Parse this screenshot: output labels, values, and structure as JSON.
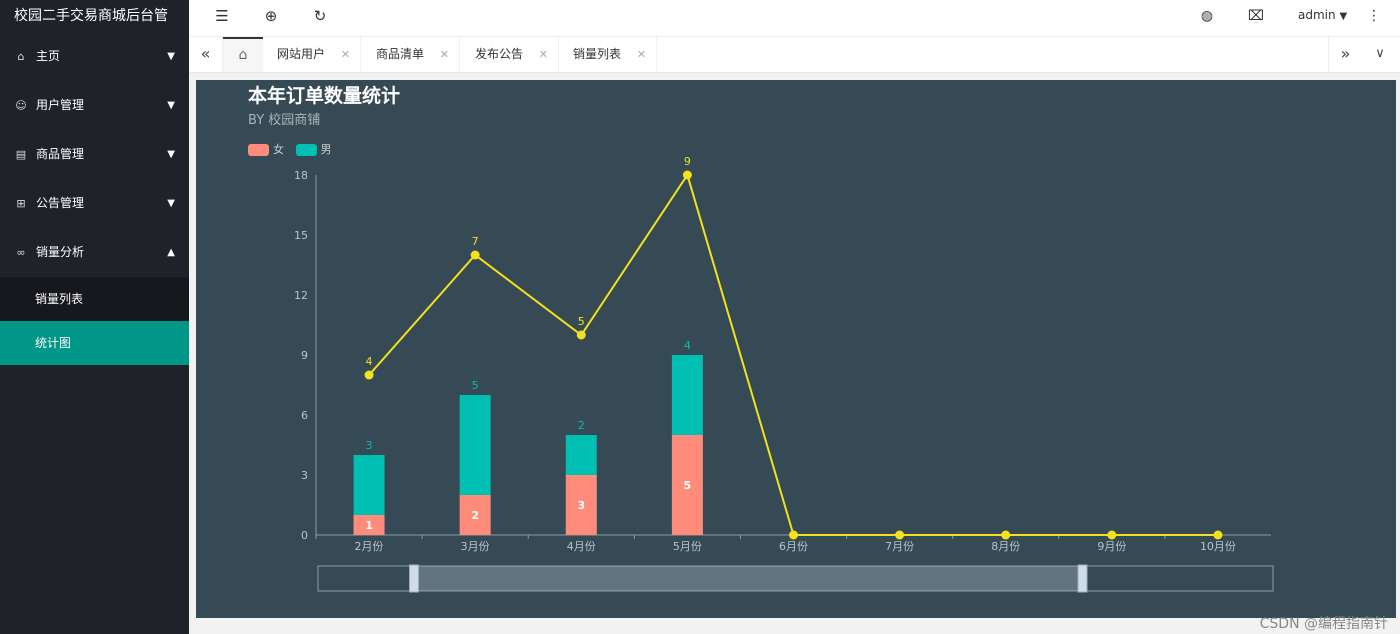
{
  "app": {
    "title": "校园二手交易商城后台管"
  },
  "sidebar": {
    "items": [
      {
        "label": "主页",
        "icon": "home-icon"
      },
      {
        "label": "用户管理",
        "icon": "user-icon"
      },
      {
        "label": "商品管理",
        "icon": "goods-icon"
      },
      {
        "label": "公告管理",
        "icon": "notice-icon"
      },
      {
        "label": "销量分析",
        "icon": "infinity-icon"
      }
    ],
    "subitems": [
      {
        "label": "销量列表",
        "active": false
      },
      {
        "label": "统计图",
        "active": true
      }
    ]
  },
  "topbar": {
    "user": "admin"
  },
  "tabs": [
    {
      "label": "网站用户"
    },
    {
      "label": "商品清单"
    },
    {
      "label": "发布公告"
    },
    {
      "label": "销量列表"
    }
  ],
  "watermark": "CSDN @编程指南针",
  "colors": {
    "female": "#ff8c7a",
    "male": "#00bfb3",
    "line": "#f5e11b"
  },
  "chart_data": {
    "type": "bar",
    "title": "本年订单数量统计",
    "subtitle": "BY 校园商铺",
    "categories": [
      "2月份",
      "3月份",
      "4月份",
      "5月份",
      "6月份",
      "7月份",
      "8月份",
      "9月份",
      "10月份"
    ],
    "series": [
      {
        "name": "女",
        "type": "bar",
        "stack": true,
        "values": [
          1,
          2,
          3,
          5,
          0,
          0,
          0,
          0,
          0
        ]
      },
      {
        "name": "男",
        "type": "bar",
        "stack": true,
        "values": [
          3,
          5,
          2,
          4,
          0,
          0,
          0,
          0,
          0
        ]
      },
      {
        "type": "line",
        "values": [
          4,
          7,
          5,
          9,
          0,
          0,
          0,
          0,
          0
        ]
      }
    ],
    "yticks": [
      "0",
      "3",
      "6",
      "9",
      "12",
      "15",
      "18"
    ],
    "ylim": [
      0,
      18
    ],
    "legend": "top-left",
    "grid": false,
    "datazoom": {
      "start": 0.1,
      "end": 0.8
    }
  }
}
